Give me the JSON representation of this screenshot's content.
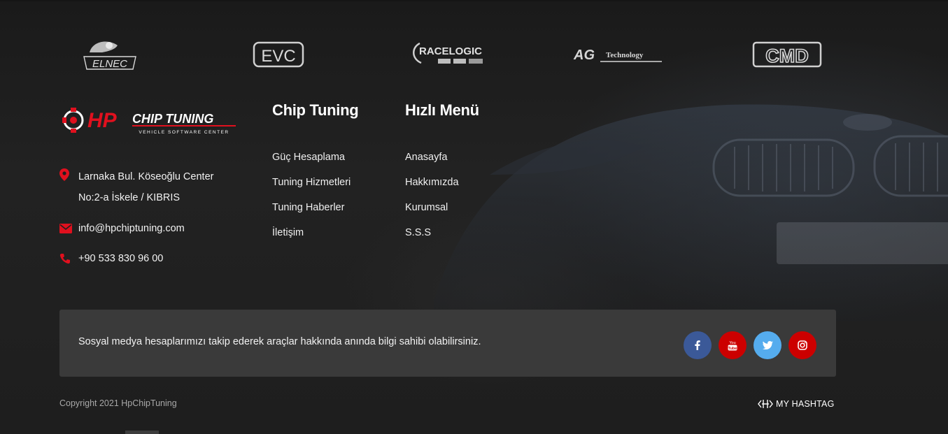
{
  "brands": [
    {
      "name": "ELNEC",
      "label": "ELNEC"
    },
    {
      "name": "EVC",
      "label": "EVC"
    },
    {
      "name": "RACELOGIC",
      "label": "RACELOGIC"
    },
    {
      "name": "AG Technology",
      "label": "Technology"
    },
    {
      "name": "CMD",
      "label": "CMD"
    }
  ],
  "logo": {
    "text": "HP CHIP TUNING",
    "tagline": "VEHICLE SOFTWARE CENTER"
  },
  "contact": {
    "address_line1": "Larnaka Bul. Köseoğlu Center",
    "address_line2": "No:2-a İskele / KIBRIS",
    "email": "info@hpchiptuning.com",
    "phone": "+90 533 830 96 00"
  },
  "chip_tuning": {
    "title": "Chip Tuning",
    "items": [
      "Güç Hesaplama",
      "Tuning Hizmetleri",
      "Tuning Haberler",
      "İletişim"
    ]
  },
  "quick_menu": {
    "title": "Hızlı Menü",
    "items": [
      "Anasayfa",
      "Hakkımızda",
      "Kurumsal",
      "S.S.S"
    ]
  },
  "social": {
    "text": "Sosyal medya hesaplarımızı takip ederek araçlar hakkında anında bilgi sahibi olabilirsiniz.",
    "icons": [
      {
        "name": "facebook-icon",
        "color": "#3b5998"
      },
      {
        "name": "youtube-icon",
        "color": "#cc0000"
      },
      {
        "name": "twitter-icon",
        "color": "#55acee"
      },
      {
        "name": "instagram-icon",
        "color": "#cc0000"
      }
    ]
  },
  "footer": {
    "copyright": "Copyright 2021 HpChipTuning",
    "agency": "MY HASHTAG"
  },
  "colors": {
    "accent": "#e0101e",
    "bar": "#3a3a3a"
  }
}
